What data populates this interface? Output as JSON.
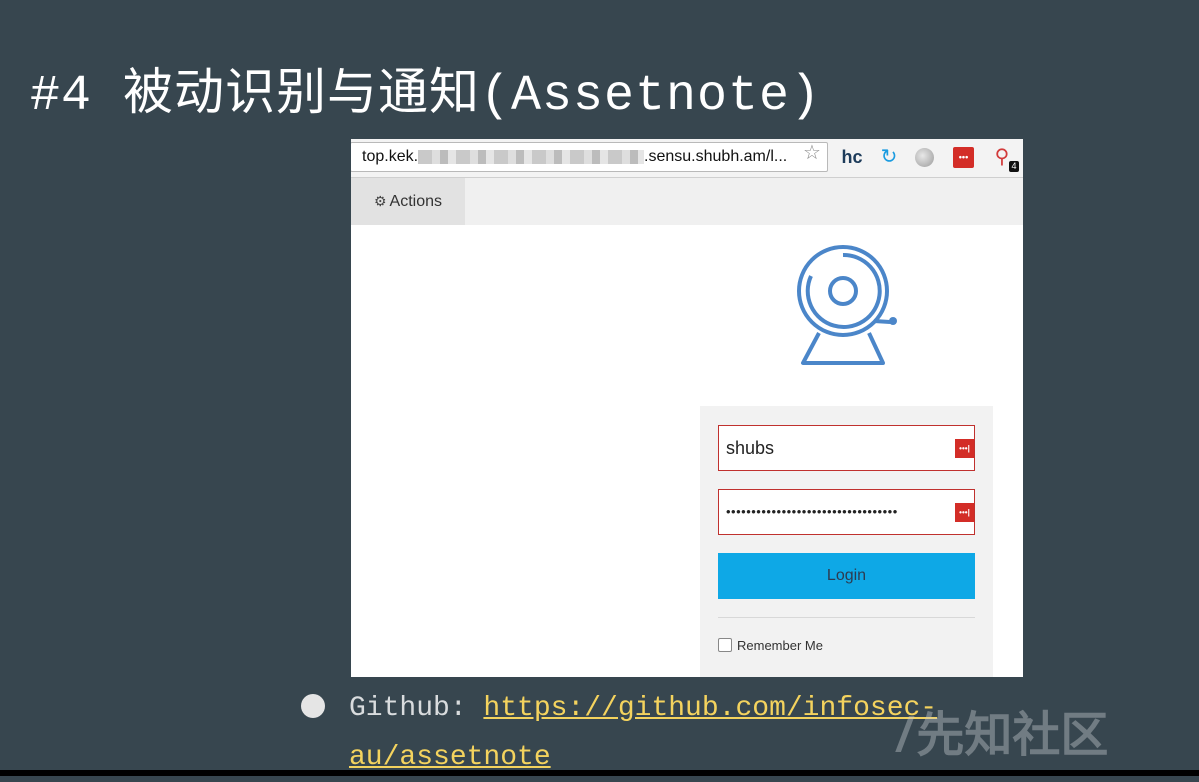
{
  "slide": {
    "title": "#4 被动识别与通知(Assetnote)"
  },
  "browser": {
    "url_prefix": "top.kek.",
    "url_suffix": ".sensu.shubh.am/l...",
    "star_icon": "☆",
    "ext_hc": "hc",
    "ext_refresh_icon": "↻",
    "ext_lastpass_icon": "•••",
    "ext_key_icon": "⚲",
    "ext_key_badge": "4"
  },
  "app": {
    "actions_label": "Actions",
    "gear_icon": "⚙",
    "login_form": {
      "username_value": "shubs",
      "password_value": "••••••••••••••••••••••••••••••••••",
      "lastpass_icon": "•••|",
      "login_button": "Login",
      "remember_label": "Remember Me"
    }
  },
  "bullet": {
    "label": "Github: ",
    "link": "https://github.com/infosec-au/assetnote"
  },
  "watermark": {
    "mark": "/",
    "text": "先知社区"
  },
  "colors": {
    "background": "#37464f",
    "logo_blue": "#4b86c9",
    "login_button": "#0ea8e6",
    "field_border": "#c0312e",
    "link": "#f4d35e"
  }
}
